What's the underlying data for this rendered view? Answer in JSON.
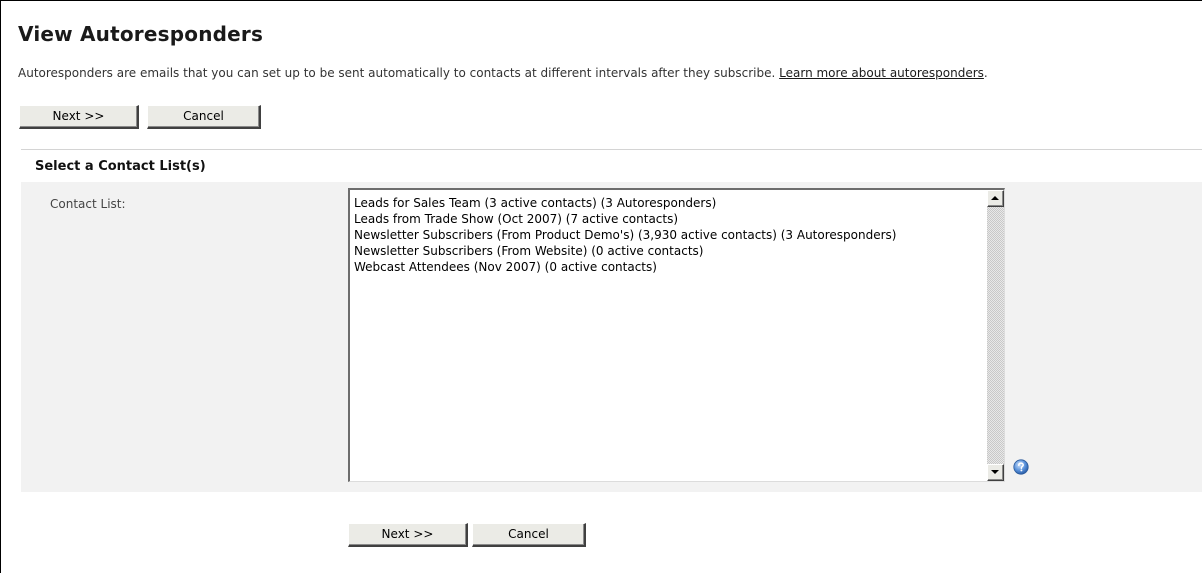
{
  "page": {
    "title": "View Autoresponders",
    "intro_text": "Autoresponders are emails that you can set up to be sent automatically to contacts at different intervals after they subscribe.",
    "intro_link": "Learn more about autoresponders",
    "intro_trailing": "."
  },
  "top_buttons": {
    "next_label": "Next >>",
    "cancel_label": "Cancel"
  },
  "section": {
    "title": "Select a Contact List(s)",
    "field_label": "Contact List:",
    "contact_lists": [
      "Leads for Sales Team (3 active contacts) (3 Autoresponders)",
      "Leads from Trade Show (Oct 2007) (7 active contacts)",
      "Newsletter Subscribers (From Product Demo's) (3,930 active contacts) (3 Autoresponders)",
      "Newsletter Subscribers (From Website) (0 active contacts)",
      "Webcast Attendees (Nov 2007) (0 active contacts)"
    ],
    "help_icon": "help-question-icon"
  },
  "bottom_buttons": {
    "next_label": "Next >>",
    "cancel_label": "Cancel"
  },
  "colors": {
    "section_background": "#f2f2f2",
    "button_face": "#ebebe6",
    "help_icon_blue": "#3a78c8"
  }
}
